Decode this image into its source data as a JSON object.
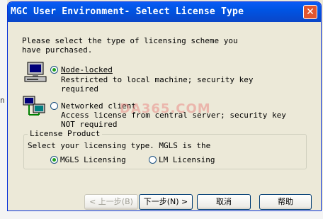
{
  "window": {
    "title": "MGC User Environment- Select License Type",
    "close_glyph": "✕"
  },
  "intro": {
    "line1": "Please select the type of licensing scheme you",
    "line2": "have purchased."
  },
  "options": {
    "node_locked": {
      "label": "Node-locked",
      "desc1": "Restricted to local machine; security key",
      "desc2": "required",
      "selected": true,
      "icon": "computer-icon"
    },
    "networked": {
      "label": "Networked client",
      "desc1": "Access license from central server; security key",
      "desc2": "NOT required",
      "selected": false,
      "icon": "network-computer-icon"
    }
  },
  "license_product": {
    "legend": "License Product",
    "prompt": "Select your licensing type. MGLS is the",
    "mgls": {
      "label": "MGLS Licensing",
      "selected": true
    },
    "lm": {
      "label": "LM Licensing",
      "selected": false
    }
  },
  "buttons": {
    "back": "< 上一步(B)",
    "next": "下一步(N) >",
    "cancel": "取消",
    "help": "帮助"
  },
  "watermark": "DA365.COM",
  "stray_text": "n"
}
